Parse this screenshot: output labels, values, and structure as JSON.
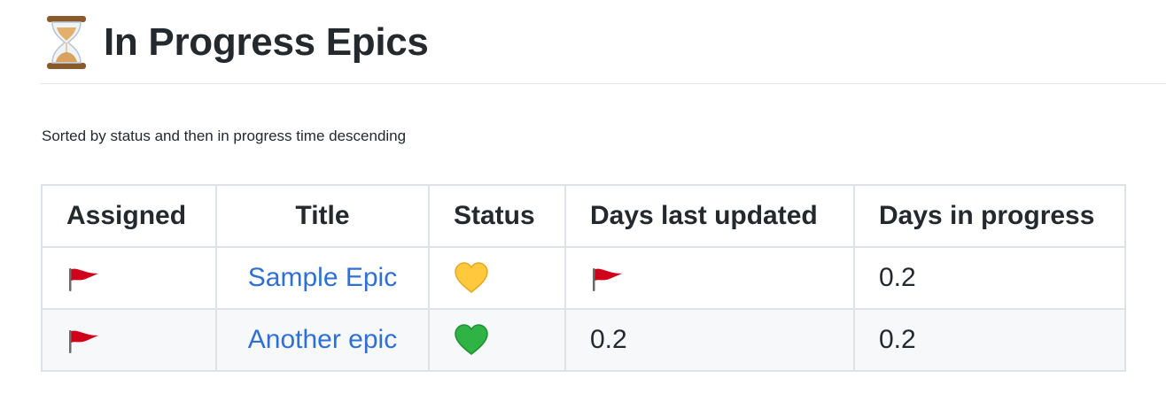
{
  "header": {
    "icon": "hourglass-icon",
    "title": "In Progress Epics"
  },
  "subtitle": "Sorted by status and then in progress time descending",
  "table": {
    "columns": [
      "Assigned",
      "Title",
      "Status",
      "Days last updated",
      "Days in progress"
    ],
    "rows": [
      {
        "assigned": "red-flag-icon",
        "title": "Sample Epic",
        "status": "yellow-heart-icon",
        "days_last_updated": "red-flag-icon",
        "days_in_progress": "0.2"
      },
      {
        "assigned": "red-flag-icon",
        "title": "Another epic",
        "status": "green-heart-icon",
        "days_last_updated": "0.2",
        "days_in_progress": "0.2"
      }
    ]
  },
  "colors": {
    "link": "#2f6fd6",
    "border": "#dfe2e5",
    "stripe": "#f6f8fa",
    "flag": "#d0021b",
    "yellow_heart": "#ffc83d",
    "green_heart": "#2fb344"
  }
}
